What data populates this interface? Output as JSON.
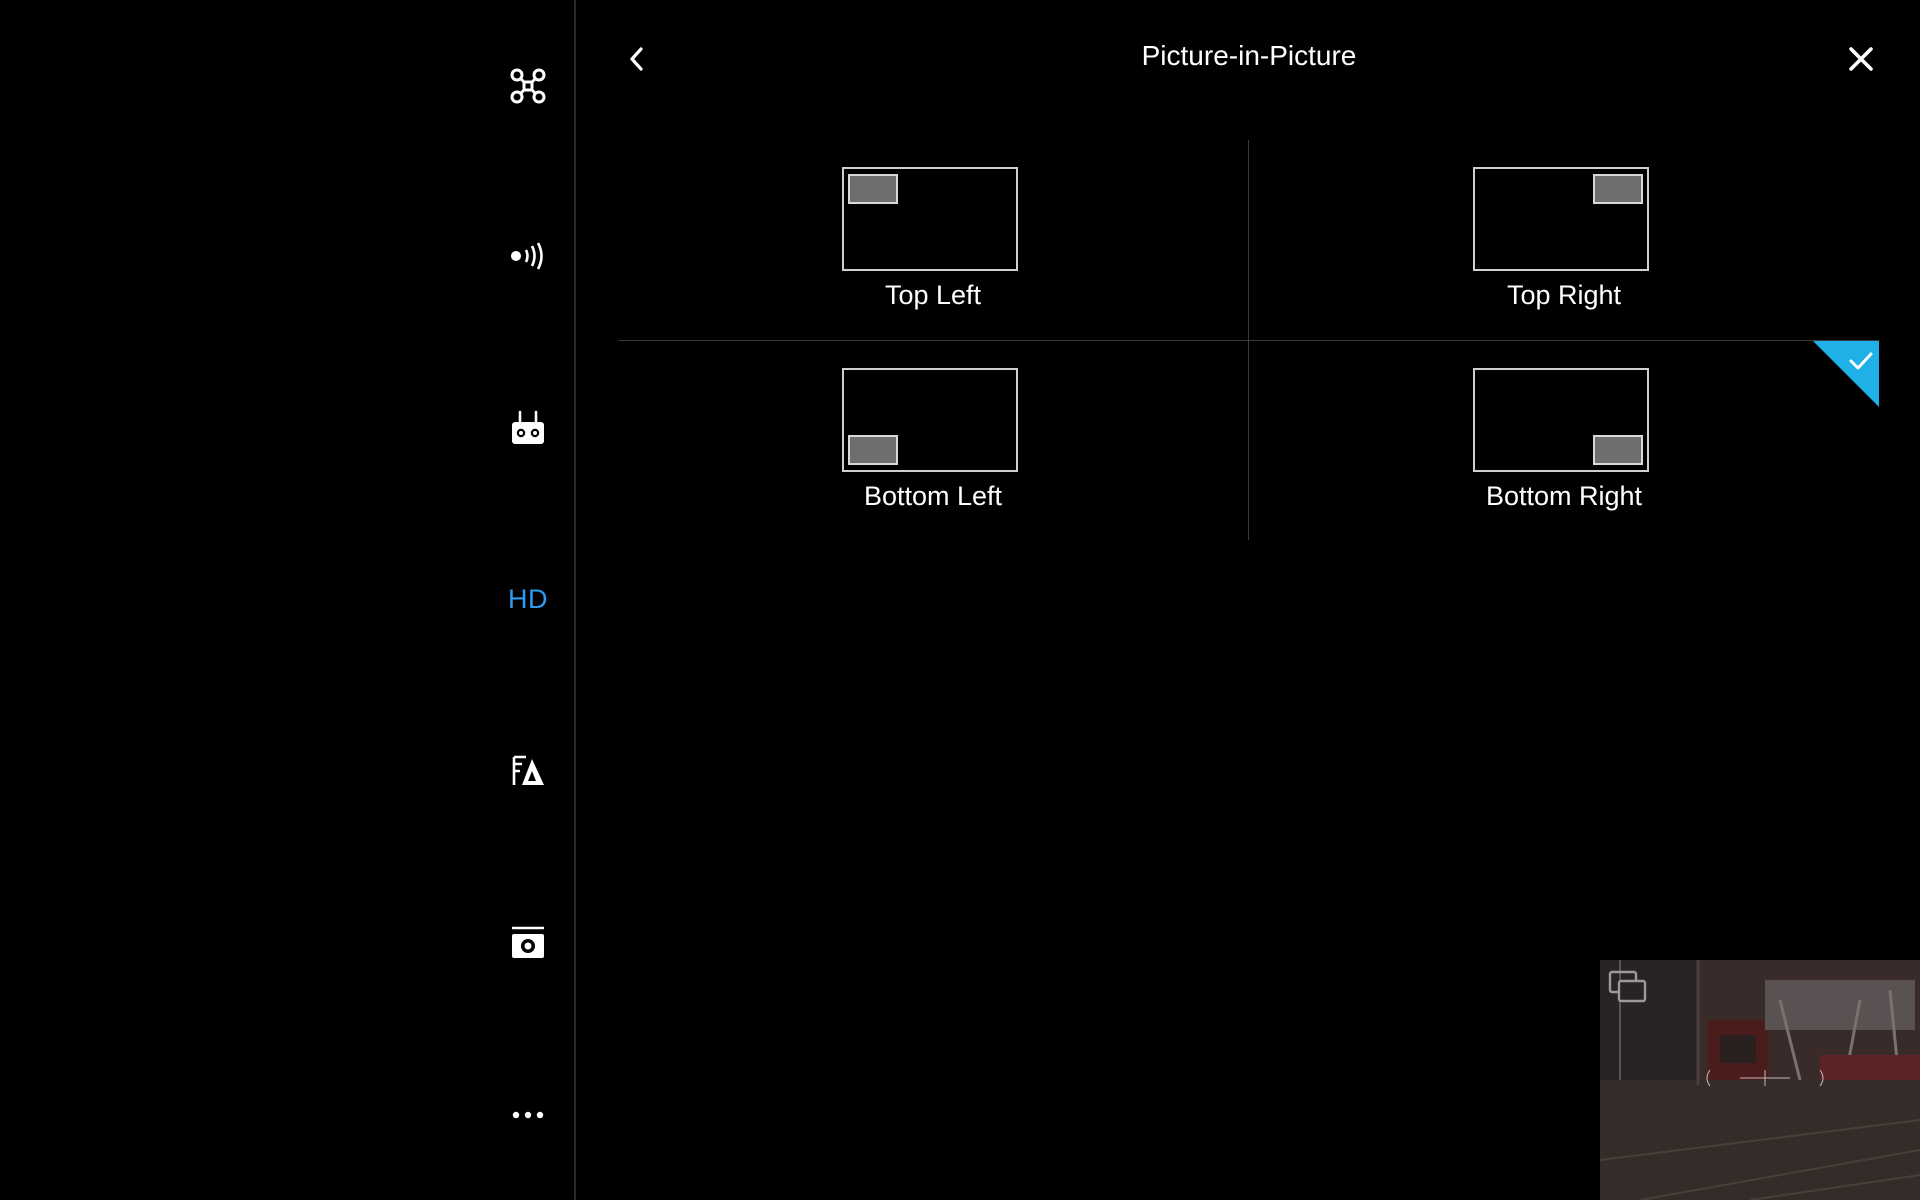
{
  "sidebar": {
    "items": [
      {
        "icon": "aircraft-icon",
        "label": ""
      },
      {
        "icon": "signal-icon",
        "label": ""
      },
      {
        "icon": "remote-controller-icon",
        "label": ""
      },
      {
        "icon": "hd-icon",
        "label": "HD"
      },
      {
        "icon": "map-navigation-icon",
        "label": ""
      },
      {
        "icon": "camera-icon",
        "label": ""
      },
      {
        "icon": "more-icon",
        "label": ""
      }
    ],
    "active_index": 3
  },
  "header": {
    "title": "Picture-in-Picture",
    "back_icon": "chevron-left-icon",
    "close_icon": "close-icon"
  },
  "options": [
    {
      "id": "top-left",
      "label": "Top Left",
      "selected": false
    },
    {
      "id": "top-right",
      "label": "Top Right",
      "selected": false
    },
    {
      "id": "bottom-left",
      "label": "Bottom Left",
      "selected": false
    },
    {
      "id": "bottom-right",
      "label": "Bottom Right",
      "selected": true
    }
  ],
  "pip": {
    "icon": "switch-view-icon"
  },
  "colors": {
    "accent": "#1fb0e8",
    "hd_accent": "#2d9cf0",
    "background": "#000000",
    "divider": "#3a3a3a"
  }
}
